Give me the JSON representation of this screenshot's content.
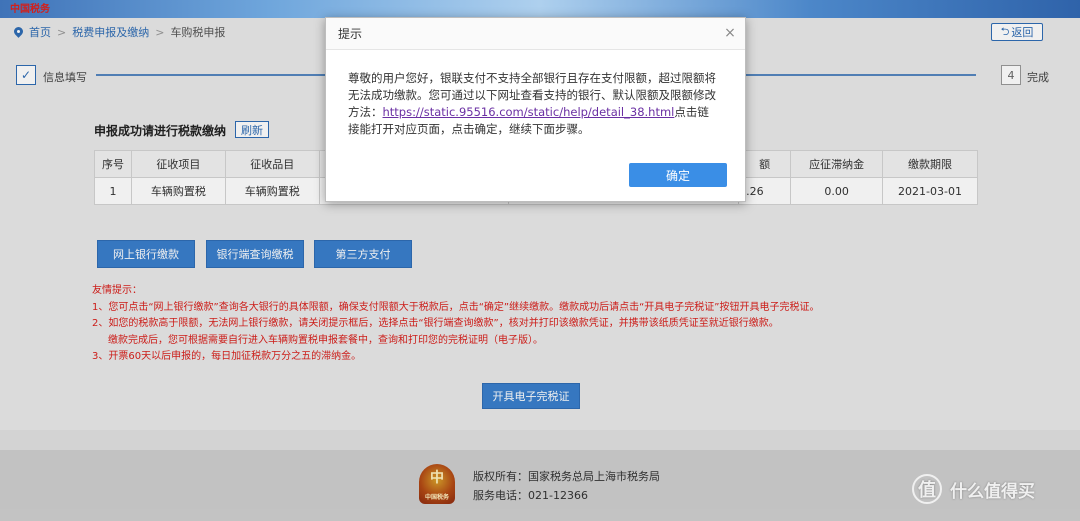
{
  "banner": {
    "brand": "中国税务"
  },
  "breadcrumb": {
    "home": "首页",
    "sep": ">",
    "level2": "税费申报及缴纳",
    "current": "车购税申报"
  },
  "back_button": {
    "label": "返回"
  },
  "steps": {
    "step1_icon": "✓",
    "step1_label": "信息填写",
    "step4_num": "4",
    "step4_label": "完成"
  },
  "section": {
    "title": "申报成功请进行税款缴纳",
    "refresh": "刷新"
  },
  "table": {
    "headers": [
      "序号",
      "征收项目",
      "征收品目",
      "",
      "",
      "额",
      "应征滞纳金",
      "缴款期限"
    ],
    "rows": [
      [
        "1",
        "车辆购置税",
        "车辆购置税",
        "",
        "",
        "7.26",
        "0.00",
        "2021-03-01"
      ]
    ]
  },
  "pay_buttons": {
    "online_bank": "网上银行缴款",
    "bank_query": "银行端查询缴税",
    "third_party": "第三方支付"
  },
  "tips": {
    "title": "友情提示：",
    "line1": "1、您可点击“网上银行缴款”查询各大银行的具体限额，确保支付限额大于税款后，点击“确定”继续缴款。缴款成功后请点击“开具电子完税证”按钮开具电子完税证。",
    "line2": "2、如您的税款高于限额，无法网上银行缴款，请关闭提示框后，选择点击“银行端查询缴款”，核对并打印该缴款凭证，并携带该纸质凭证至就近银行缴款。",
    "line2b": "缴款完成后，您可根据需要自行进入车辆购置税申报套餐中，查询和打印您的完税证明（电子版）。",
    "line3": "3、开票60天以后申报的，每日加征税款万分之五的滞纳金。"
  },
  "cert_button": {
    "label": "开具电子完税证"
  },
  "footer": {
    "emblem": "中",
    "emblem_sub": "中国税务",
    "copyright": "版权所有：国家税务总局上海市税务局",
    "phone": "服务电话：021-12366"
  },
  "watermark": {
    "text": "什么值得买",
    "logo": "值"
  },
  "modal": {
    "title": "提示",
    "close": "×",
    "text_before": "尊敬的用户您好，银联支付不支持全部银行且存在支付限额，超过限额将无法成功缴款。您可通过以下网址查看支持的银行、默认限额及限额修改方法：",
    "link": "https://static.95516.com/static/help/detail_38.html",
    "text_after": "点击链接能打开对应页面，点击确定，继续下面步骤。",
    "ok": "确定"
  }
}
